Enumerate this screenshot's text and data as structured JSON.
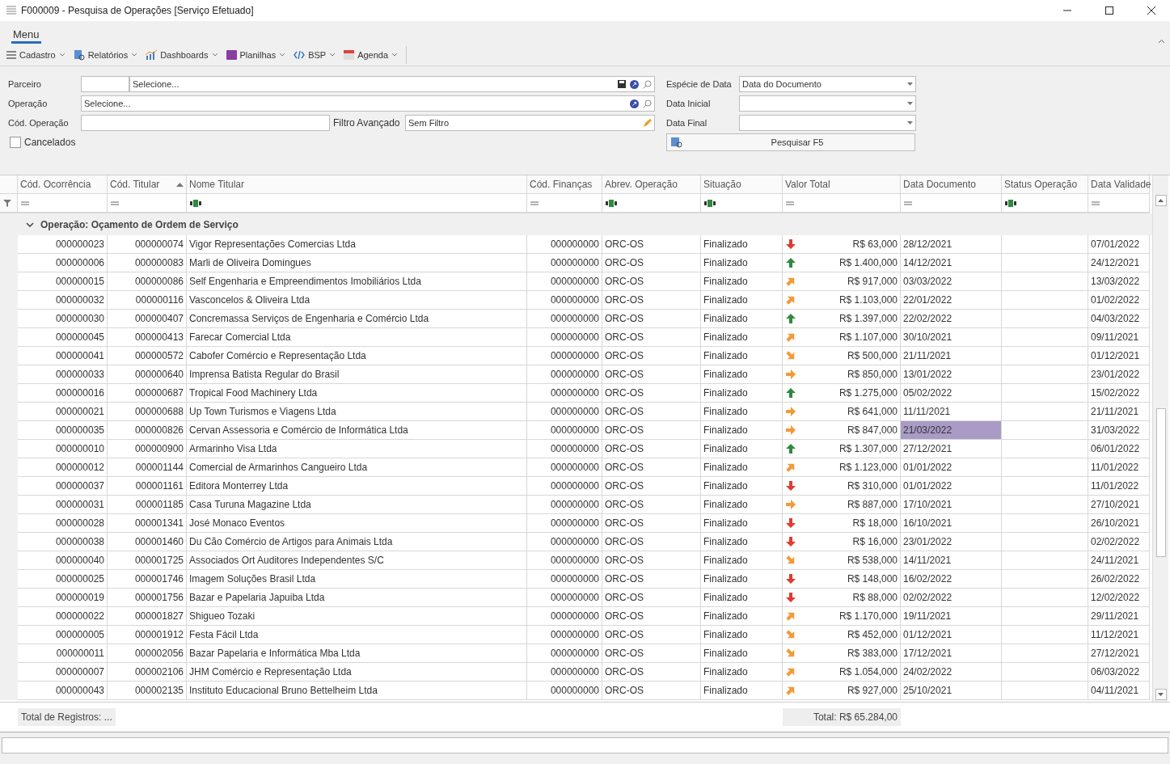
{
  "window": {
    "title": "F000009 - Pesquisa de Operações [Serviço Efetuado]"
  },
  "menu_tab": {
    "label": "Menu",
    "selected": true
  },
  "toolbar": [
    {
      "kind": "list",
      "label": "Cadastro"
    },
    {
      "kind": "report",
      "label": "Relatórios"
    },
    {
      "kind": "chart",
      "label": "Dashboards"
    },
    {
      "kind": "sheet",
      "label": "Planilhas"
    },
    {
      "kind": "code",
      "label": "BSP"
    },
    {
      "kind": "calendar",
      "label": "Agenda"
    }
  ],
  "filters": {
    "parceiro": {
      "label": "Parceiro",
      "placeholder": "Selecione..."
    },
    "operacao": {
      "label": "Operação",
      "placeholder": "Selecione..."
    },
    "cod_operacao": {
      "label": "Cód. Operação"
    },
    "filtro_avancado": {
      "label": "Filtro Avançado",
      "value": "Sem Filtro"
    },
    "cancelados": {
      "label": "Cancelados",
      "checked": false
    },
    "especie_data": {
      "label": "Espécie de Data",
      "value": "Data do Documento"
    },
    "data_inicial": {
      "label": "Data Inicial"
    },
    "data_final": {
      "label": "Data Final"
    },
    "search_button": "Pesquisar F5"
  },
  "table": {
    "columns": [
      {
        "label": "Cód. Ocorrência",
        "kind": "equals"
      },
      {
        "label": "Cód. Titular",
        "kind": "equals",
        "sorted": true
      },
      {
        "label": "Nome Titular",
        "kind": "text"
      },
      {
        "label": "Cód. Finanças",
        "kind": "equals"
      },
      {
        "label": "Abrev. Operação",
        "kind": "text"
      },
      {
        "label": "Situação",
        "kind": "text"
      },
      {
        "label": "Valor Total",
        "kind": "equals"
      },
      {
        "label": "Data Documento",
        "kind": "equals"
      },
      {
        "label": "Status Operação",
        "kind": "text"
      },
      {
        "label": "Data Validade",
        "kind": "equals"
      }
    ],
    "group": {
      "label": "Operação: Oçamento de Ordem de Serviço",
      "expanded": true
    },
    "rows": [
      {
        "cells": [
          "000000023",
          "000000074",
          "Vigor Representações Comercias Ltda",
          "000000000",
          "ORC-OS",
          "Finalizado",
          "R$ 63,000",
          "28/12/2021",
          "07/01/2022"
        ],
        "kind": "down",
        "selected": false
      },
      {
        "cells": [
          "000000006",
          "000000083",
          "Marli de Oliveira Domingues",
          "000000000",
          "ORC-OS",
          "Finalizado",
          "R$ 1.400,000",
          "14/12/2021",
          "24/12/2021"
        ],
        "kind": "up",
        "selected": false
      },
      {
        "cells": [
          "000000015",
          "000000086",
          "Self Engenharia e Empreendimentos Imobiliários Ltda",
          "000000000",
          "ORC-OS",
          "Finalizado",
          "R$ 917,000",
          "03/03/2022",
          "13/03/2022"
        ],
        "kind": "up-right",
        "selected": false
      },
      {
        "cells": [
          "000000032",
          "000000116",
          "Vasconcelos & Oliveira Ltda",
          "000000000",
          "ORC-OS",
          "Finalizado",
          "R$ 1.103,000",
          "22/01/2022",
          "01/02/2022"
        ],
        "kind": "up-right",
        "selected": false
      },
      {
        "cells": [
          "000000030",
          "000000407",
          "Concremassa Serviços de Engenharia e Comércio Ltda",
          "000000000",
          "ORC-OS",
          "Finalizado",
          "R$ 1.397,000",
          "22/02/2022",
          "04/03/2022"
        ],
        "kind": "up",
        "selected": false
      },
      {
        "cells": [
          "000000045",
          "000000413",
          "Farecar Comercial Ltda",
          "000000000",
          "ORC-OS",
          "Finalizado",
          "R$ 1.107,000",
          "30/10/2021",
          "09/11/2021"
        ],
        "kind": "up-right",
        "selected": false
      },
      {
        "cells": [
          "000000041",
          "000000572",
          "Cabofer Comércio e Representação Ltda",
          "000000000",
          "ORC-OS",
          "Finalizado",
          "R$ 500,000",
          "21/11/2021",
          "01/12/2021"
        ],
        "kind": "down-right",
        "selected": false
      },
      {
        "cells": [
          "000000033",
          "000000640",
          "Imprensa Batista Regular do Brasil",
          "000000000",
          "ORC-OS",
          "Finalizado",
          "R$ 850,000",
          "13/01/2022",
          "23/01/2022"
        ],
        "kind": "right",
        "selected": false
      },
      {
        "cells": [
          "000000016",
          "000000687",
          "Tropical Food Machinery Ltda",
          "000000000",
          "ORC-OS",
          "Finalizado",
          "R$ 1.275,000",
          "05/02/2022",
          "15/02/2022"
        ],
        "kind": "up",
        "selected": false
      },
      {
        "cells": [
          "000000021",
          "000000688",
          "Up Town Turismos e Viagens Ltda",
          "000000000",
          "ORC-OS",
          "Finalizado",
          "R$ 641,000",
          "11/11/2021",
          "21/11/2021"
        ],
        "kind": "right",
        "selected": false
      },
      {
        "cells": [
          "000000035",
          "000000826",
          "Cervan Assessoria e Comércio de Informática Ltda",
          "000000000",
          "ORC-OS",
          "Finalizado",
          "R$ 847,000",
          "21/03/2022",
          "31/03/2022"
        ],
        "kind": "right",
        "selected": true
      },
      {
        "cells": [
          "000000010",
          "000000900",
          "Armarinho Visa Ltda",
          "000000000",
          "ORC-OS",
          "Finalizado",
          "R$ 1.307,000",
          "27/12/2021",
          "06/01/2022"
        ],
        "kind": "up",
        "selected": false
      },
      {
        "cells": [
          "000000012",
          "000001144",
          "Comercial de Armarinhos Cangueiro Ltda",
          "000000000",
          "ORC-OS",
          "Finalizado",
          "R$ 1.123,000",
          "01/01/2022",
          "11/01/2022"
        ],
        "kind": "up-right",
        "selected": false
      },
      {
        "cells": [
          "000000037",
          "000001161",
          "Editora Monterrey Ltda",
          "000000000",
          "ORC-OS",
          "Finalizado",
          "R$ 310,000",
          "01/01/2022",
          "11/01/2022"
        ],
        "kind": "down",
        "selected": false
      },
      {
        "cells": [
          "000000031",
          "000001185",
          "Casa Turuna Magazine Ltda",
          "000000000",
          "ORC-OS",
          "Finalizado",
          "R$ 887,000",
          "17/10/2021",
          "27/10/2021"
        ],
        "kind": "right",
        "selected": false
      },
      {
        "cells": [
          "000000028",
          "000001341",
          "José Monaco Eventos",
          "000000000",
          "ORC-OS",
          "Finalizado",
          "R$ 18,000",
          "16/10/2021",
          "26/10/2021"
        ],
        "kind": "down",
        "selected": false
      },
      {
        "cells": [
          "000000038",
          "000001460",
          "Du Cão Comércio de Artigos para Animais Ltda",
          "000000000",
          "ORC-OS",
          "Finalizado",
          "R$ 16,000",
          "23/01/2022",
          "02/02/2022"
        ],
        "kind": "down",
        "selected": false
      },
      {
        "cells": [
          "000000040",
          "000001725",
          "Associados Ort Auditores Independentes S/C",
          "000000000",
          "ORC-OS",
          "Finalizado",
          "R$ 538,000",
          "14/11/2021",
          "24/11/2021"
        ],
        "kind": "down-right",
        "selected": false
      },
      {
        "cells": [
          "000000025",
          "000001746",
          "Imagem Soluções Brasil Ltda",
          "000000000",
          "ORC-OS",
          "Finalizado",
          "R$ 148,000",
          "16/02/2022",
          "26/02/2022"
        ],
        "kind": "down",
        "selected": false
      },
      {
        "cells": [
          "000000019",
          "000001756",
          "Bazar e Papelaria Japuiba Ltda",
          "000000000",
          "ORC-OS",
          "Finalizado",
          "R$ 88,000",
          "02/02/2022",
          "12/02/2022"
        ],
        "kind": "down",
        "selected": false
      },
      {
        "cells": [
          "000000022",
          "000001827",
          "Shigueo Tozaki",
          "000000000",
          "ORC-OS",
          "Finalizado",
          "R$ 1.170,000",
          "19/11/2021",
          "29/11/2021"
        ],
        "kind": "up-right",
        "selected": false
      },
      {
        "cells": [
          "000000005",
          "000001912",
          "Festa Fácil Ltda",
          "000000000",
          "ORC-OS",
          "Finalizado",
          "R$ 452,000",
          "01/12/2021",
          "11/12/2021"
        ],
        "kind": "down-right",
        "selected": false
      },
      {
        "cells": [
          "000000011",
          "000002056",
          "Bazar Papelaria e Informática Mba Ltda",
          "000000000",
          "ORC-OS",
          "Finalizado",
          "R$ 383,000",
          "17/12/2021",
          "27/12/2021"
        ],
        "kind": "down-right",
        "selected": false
      },
      {
        "cells": [
          "000000007",
          "000002106",
          "JHM Comércio e Representação Ltda",
          "000000000",
          "ORC-OS",
          "Finalizado",
          "R$ 1.054,000",
          "24/02/2022",
          "06/03/2022"
        ],
        "kind": "up-right",
        "selected": false
      },
      {
        "cells": [
          "000000043",
          "000002135",
          "Instituto Educacional Bruno Bettelheim Ltda",
          "000000000",
          "ORC-OS",
          "Finalizado",
          "R$ 927,000",
          "25/10/2021",
          "04/11/2021"
        ],
        "kind": "up-right",
        "selected": false
      }
    ]
  },
  "footer": {
    "record_count": "Total de Registros: ...",
    "total": "Total: R$ 65.284,00"
  }
}
